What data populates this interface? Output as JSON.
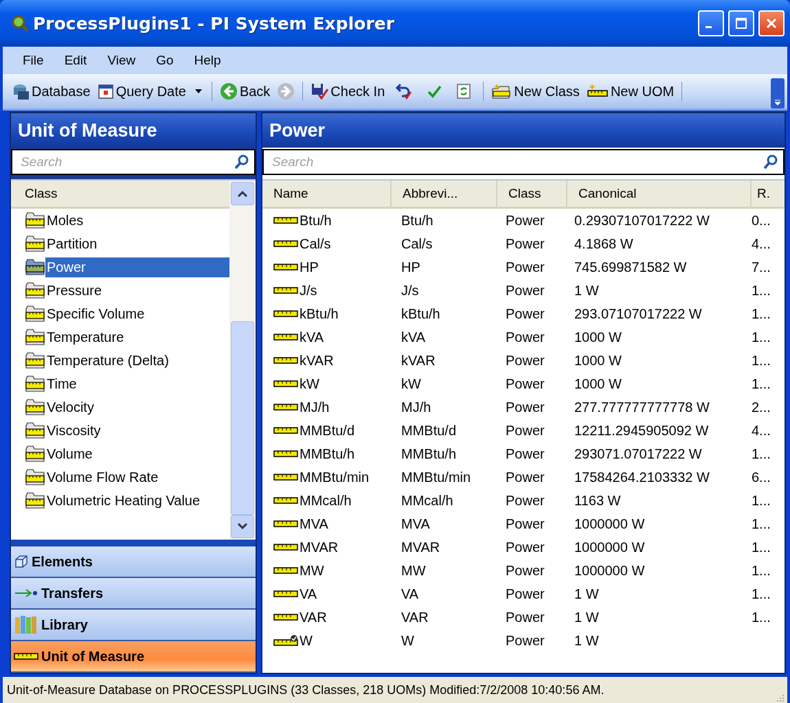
{
  "window": {
    "title": "ProcessPlugins1 - PI System Explorer"
  },
  "menu": [
    "File",
    "Edit",
    "View",
    "Go",
    "Help"
  ],
  "toolbar": {
    "database": "Database",
    "query_date": "Query Date",
    "back": "Back",
    "forward": {
      "disabled": true
    },
    "check_in": "Check In",
    "new_class": "New Class",
    "new_uom": "New UOM"
  },
  "left_panel": {
    "title": "Unit of Measure",
    "search": {
      "placeholder": "Search"
    },
    "column": "Class",
    "items": [
      {
        "label": "Moles",
        "selected": false
      },
      {
        "label": "Partition",
        "selected": false
      },
      {
        "label": "Power",
        "selected": true
      },
      {
        "label": "Pressure",
        "selected": false
      },
      {
        "label": "Specific Volume",
        "selected": false
      },
      {
        "label": "Temperature",
        "selected": false
      },
      {
        "label": "Temperature (Delta)",
        "selected": false
      },
      {
        "label": "Time",
        "selected": false
      },
      {
        "label": "Velocity",
        "selected": false
      },
      {
        "label": "Viscosity",
        "selected": false
      },
      {
        "label": "Volume",
        "selected": false
      },
      {
        "label": "Volume Flow Rate",
        "selected": false
      },
      {
        "label": "Volumetric Heating Value",
        "selected": false
      }
    ]
  },
  "navigation": [
    {
      "label": "Elements",
      "selected": false
    },
    {
      "label": "Transfers",
      "selected": false
    },
    {
      "label": "Library",
      "selected": false
    },
    {
      "label": "Unit of Measure",
      "selected": true
    }
  ],
  "right_panel": {
    "title": "Power",
    "search": {
      "placeholder": "Search"
    },
    "columns": [
      "Name",
      "Abbrevi...",
      "Class",
      "Canonical",
      "R."
    ],
    "rows": [
      {
        "name": "Btu/h",
        "abbreviation": "Btu/h",
        "class": "Power",
        "canonical": "0.29307107017222 W",
        "column_5": "0...",
        "default": false
      },
      {
        "name": "Cal/s",
        "abbreviation": "Cal/s",
        "class": "Power",
        "canonical": "4.1868 W",
        "column_5": "4...",
        "default": false
      },
      {
        "name": "HP",
        "abbreviation": "HP",
        "class": "Power",
        "canonical": "745.699871582 W",
        "column_5": "7...",
        "default": false
      },
      {
        "name": "J/s",
        "abbreviation": "J/s",
        "class": "Power",
        "canonical": "1 W",
        "column_5": "1...",
        "default": false
      },
      {
        "name": "kBtu/h",
        "abbreviation": "kBtu/h",
        "class": "Power",
        "canonical": "293.07107017222 W",
        "column_5": "1...",
        "default": false
      },
      {
        "name": "kVA",
        "abbreviation": "kVA",
        "class": "Power",
        "canonical": "1000 W",
        "column_5": "1...",
        "default": false
      },
      {
        "name": "kVAR",
        "abbreviation": "kVAR",
        "class": "Power",
        "canonical": "1000 W",
        "column_5": "1...",
        "default": false
      },
      {
        "name": "kW",
        "abbreviation": "kW",
        "class": "Power",
        "canonical": "1000 W",
        "column_5": "1...",
        "default": false
      },
      {
        "name": "MJ/h",
        "abbreviation": "MJ/h",
        "class": "Power",
        "canonical": "277.777777777778 W",
        "column_5": "2...",
        "default": false
      },
      {
        "name": "MMBtu/d",
        "abbreviation": "MMBtu/d",
        "class": "Power",
        "canonical": "12211.2945905092 W",
        "column_5": "4...",
        "default": false
      },
      {
        "name": "MMBtu/h",
        "abbreviation": "MMBtu/h",
        "class": "Power",
        "canonical": "293071.07017222 W",
        "column_5": "1...",
        "default": false
      },
      {
        "name": "MMBtu/min",
        "abbreviation": "MMBtu/min",
        "class": "Power",
        "canonical": "17584264.2103332 W",
        "column_5": "6...",
        "default": false
      },
      {
        "name": "MMcal/h",
        "abbreviation": "MMcal/h",
        "class": "Power",
        "canonical": "1163 W",
        "column_5": "1...",
        "default": false
      },
      {
        "name": "MVA",
        "abbreviation": "MVA",
        "class": "Power",
        "canonical": "1000000 W",
        "column_5": "1...",
        "default": false
      },
      {
        "name": "MVAR",
        "abbreviation": "MVAR",
        "class": "Power",
        "canonical": "1000000 W",
        "column_5": "1...",
        "default": false
      },
      {
        "name": "MW",
        "abbreviation": "MW",
        "class": "Power",
        "canonical": "1000000 W",
        "column_5": "1...",
        "default": false
      },
      {
        "name": "VA",
        "abbreviation": "VA",
        "class": "Power",
        "canonical": "1 W",
        "column_5": "1...",
        "default": false
      },
      {
        "name": "VAR",
        "abbreviation": "VAR",
        "class": "Power",
        "canonical": "1 W",
        "column_5": "1...",
        "default": false
      },
      {
        "name": "W",
        "abbreviation": "W",
        "class": "Power",
        "canonical": "1 W",
        "default": true
      }
    ]
  },
  "status_bar": "Unit-of-Measure Database on PROCESSPLUGINS (33 Classes, 218 UOMs)  Modified:7/2/2008 10:40:56 AM."
}
